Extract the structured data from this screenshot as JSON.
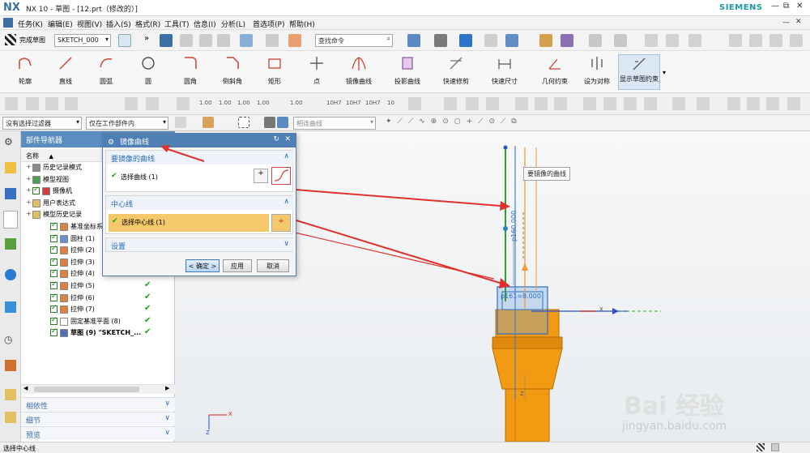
{
  "app": {
    "logo": "NX",
    "window_title": "NX 10 - 草图 - [12.prt（修改的）]",
    "brand": "SIEMENS",
    "win_buttons": [
      "—",
      "⧉",
      "✕"
    ]
  },
  "menubar": {
    "items": [
      "任务(K)",
      "编辑(E)",
      "视图(V)",
      "插入(S)",
      "格式(R)",
      "工具(T)",
      "信息(I)",
      "分析(L)",
      "首选项(P)",
      "帮助(H)"
    ]
  },
  "toolbar1": {
    "finish_label": "完成草图",
    "sketch_name": "SKETCH_000",
    "command_search_placeholder": "查找命令"
  },
  "ribbon": {
    "items": [
      "轮廓",
      "直线",
      "圆弧",
      "圆",
      "圆角",
      "倒斜角",
      "矩形",
      "点",
      "镜像曲线",
      "投影曲线",
      "快速修剪",
      "快速尺寸",
      "几何约束",
      "设为对称",
      "显示草图约束"
    ]
  },
  "toolbar3": {
    "dims": [
      "1.00",
      "1.00",
      "1.00",
      "1.00",
      "1.00",
      "10H7",
      "10H7",
      "10H7",
      "10"
    ]
  },
  "filterbar": {
    "filter": "没有选择过滤器",
    "scope": "仅在工作部件内",
    "curve_rule": "相连曲线"
  },
  "navigator": {
    "title": "部件导航器",
    "col_name": "名称",
    "rows": [
      {
        "label": "历史记录模式",
        "indent": 1,
        "check": false,
        "tick": false,
        "bold": false
      },
      {
        "label": "模型视图",
        "indent": 1,
        "check": false,
        "tick": false,
        "bold": false
      },
      {
        "label": "摄像机",
        "indent": 1,
        "check": true,
        "tick": false,
        "bold": false
      },
      {
        "label": "用户表达式",
        "indent": 1,
        "check": false,
        "tick": false,
        "bold": false
      },
      {
        "label": "模型历史记录",
        "indent": 1,
        "check": false,
        "tick": false,
        "bold": false
      },
      {
        "label": "基准坐标系",
        "indent": 2,
        "check": true,
        "tick": false,
        "bold": false
      },
      {
        "label": "圆柱 (1)",
        "indent": 2,
        "check": true,
        "tick": false,
        "bold": false
      },
      {
        "label": "拉伸 (2)",
        "indent": 2,
        "check": true,
        "tick": false,
        "bold": false
      },
      {
        "label": "拉伸 (3)",
        "indent": 2,
        "check": true,
        "tick": false,
        "bold": false
      },
      {
        "label": "拉伸 (4)",
        "indent": 2,
        "check": true,
        "tick": false,
        "bold": false
      },
      {
        "label": "拉伸 (5)",
        "indent": 2,
        "check": true,
        "tick": true,
        "bold": false
      },
      {
        "label": "拉伸 (6)",
        "indent": 2,
        "check": true,
        "tick": true,
        "bold": false
      },
      {
        "label": "拉伸 (7)",
        "indent": 2,
        "check": true,
        "tick": true,
        "bold": false
      },
      {
        "label": "固定基准平面 (8)",
        "indent": 2,
        "check": true,
        "tick": true,
        "bold": false
      },
      {
        "label": "草图 (9) \"SKETCH_...",
        "indent": 2,
        "check": true,
        "tick": true,
        "bold": true
      }
    ],
    "accordions": [
      "相依性",
      "细节",
      "预览"
    ]
  },
  "dialog": {
    "title": "镜像曲线",
    "section_curve": "要镜像的曲线",
    "select_curve": "选择曲线 (1)",
    "section_center": "中心线",
    "select_centerline": "选择中心线 (1)",
    "section_settings": "设置",
    "ok": "< 确定 >",
    "apply": "应用",
    "cancel": "取消"
  },
  "viewport": {
    "tag_label": "要镜像的曲线",
    "dim_vertical": "p160.000",
    "dim_horizontal": "p161=8.000",
    "axis_z_label": "Z",
    "axis_x_label": "X",
    "axis_y_label": "Y",
    "triad_z": "Z",
    "triad_x": "X"
  },
  "status": {
    "text": "选择中心线"
  },
  "watermark": {
    "big": "Bai 经验",
    "small": "jingyan.baidu.com"
  },
  "colors": {
    "part_orange": "#f29b12",
    "part_dark": "#c27508",
    "dialog_title": "#4f7fb4",
    "highlight": "#f5c86b",
    "arrow_red": "#e0322c"
  }
}
